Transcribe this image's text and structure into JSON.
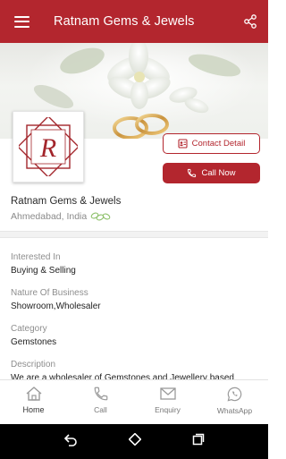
{
  "appbar": {
    "title": "Ratnam Gems & Jewels",
    "menu_icon": "hamburger-menu-icon",
    "share_icon": "share-icon"
  },
  "colors": {
    "primary": "#b3262e",
    "background": "#ffffff"
  },
  "business": {
    "name": "Ratnam Gems & Jewels",
    "location": "Ahmedabad, India",
    "logo_letter": "R"
  },
  "actions": {
    "contact_label": "Contact Detail",
    "call_label": "Call Now"
  },
  "details": [
    {
      "label": "Interested In",
      "value": "Buying & Selling"
    },
    {
      "label": "Nature Of Business",
      "value": "Showroom,Wholesaler"
    },
    {
      "label": "Category",
      "value": "Gemstones"
    },
    {
      "label": "Description",
      "value": "We are a wholesaler of Gemstones and Jewellery based"
    }
  ],
  "bottom_nav": [
    {
      "label": "Home",
      "icon": "home-icon",
      "active": true
    },
    {
      "label": "Call",
      "icon": "phone-icon",
      "active": false
    },
    {
      "label": "Enquiry",
      "icon": "mail-icon",
      "active": false
    },
    {
      "label": "WhatsApp",
      "icon": "whatsapp-icon",
      "active": false
    }
  ]
}
